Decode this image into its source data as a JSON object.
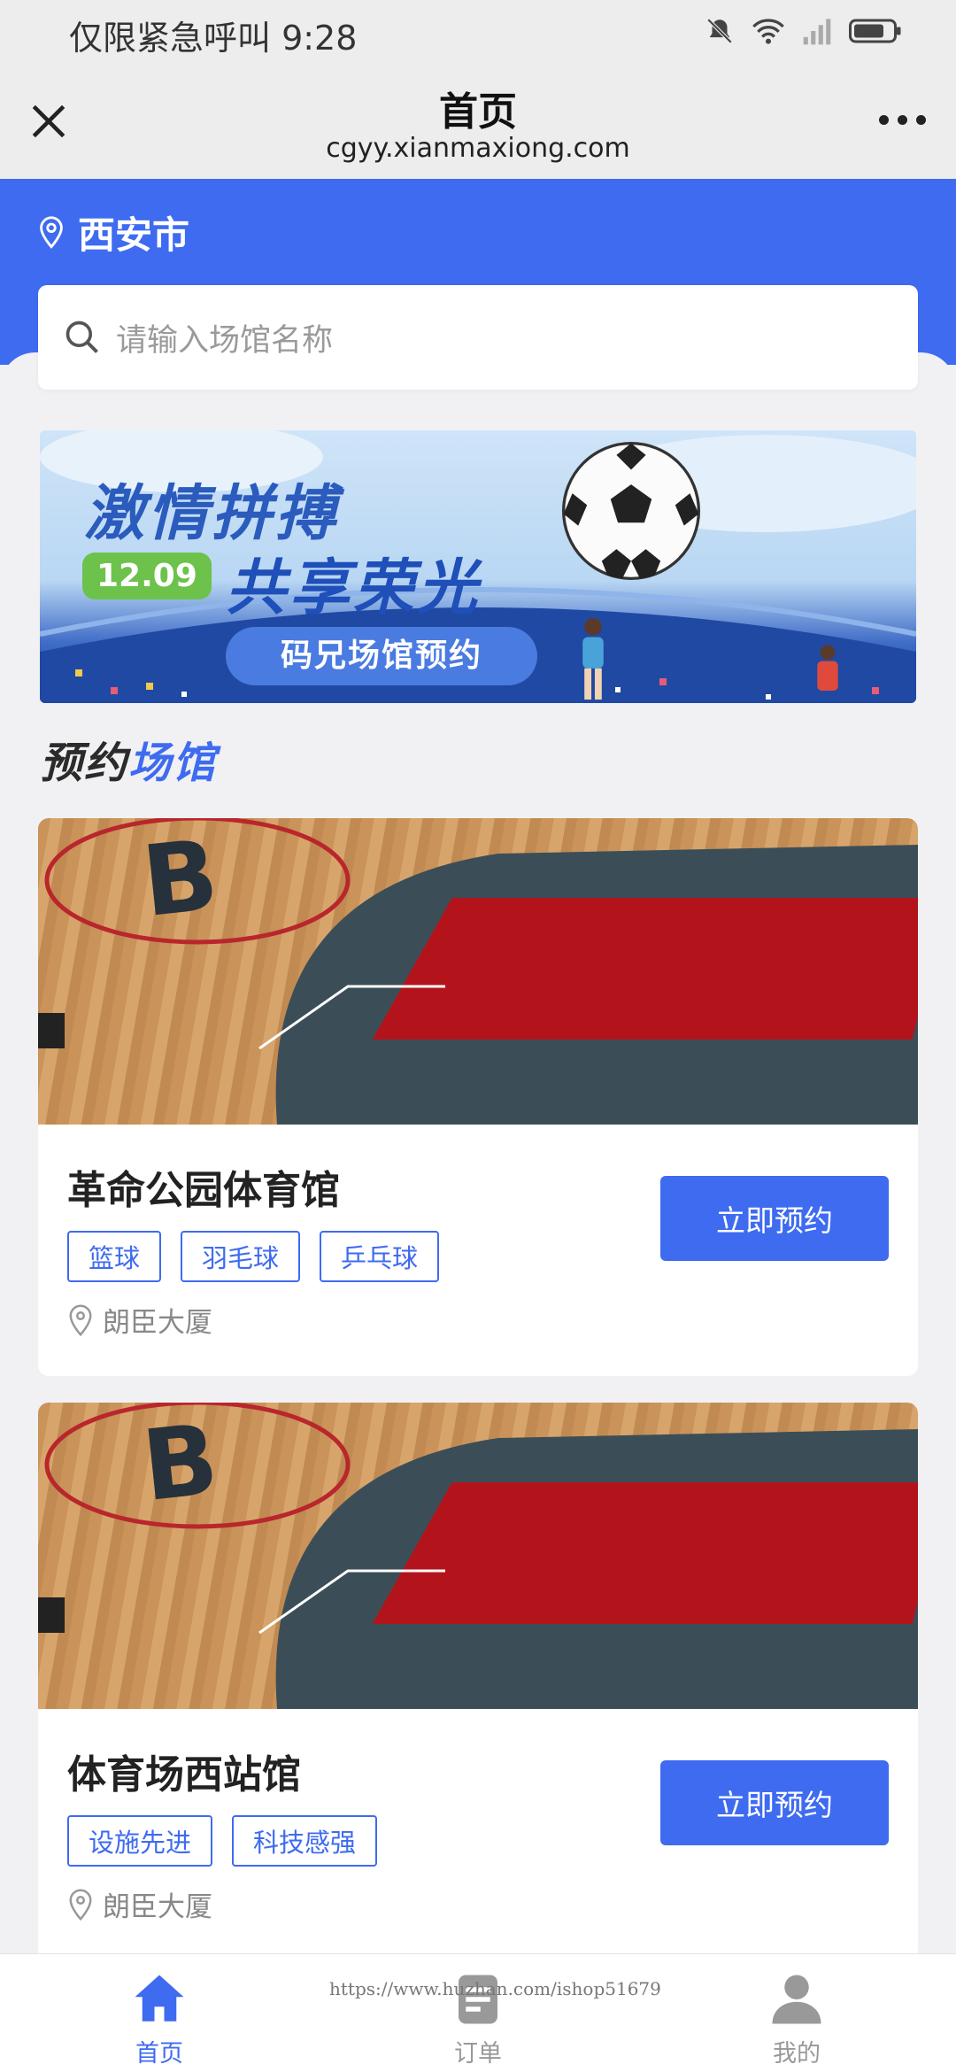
{
  "status_bar": {
    "text": "仅限紧急呼叫 9:28"
  },
  "nav": {
    "title": "首页",
    "domain": "cgyy.xianmaxiong.com"
  },
  "location": {
    "city": "西安市"
  },
  "search": {
    "placeholder": "请输入场馆名称"
  },
  "banner": {
    "line1": "激情拼搏",
    "date": "12.09",
    "line2": "共享荣光",
    "subtitle": "码兄场馆预约"
  },
  "section": {
    "title_part1": "预约",
    "title_part2": "场馆"
  },
  "venues": [
    {
      "name": "革命公园体育馆",
      "tags": [
        "篮球",
        "羽毛球",
        "乒乓球"
      ],
      "address": "朗臣大厦",
      "button": "立即预约"
    },
    {
      "name": "体育场西站馆",
      "tags": [
        "设施先进",
        "科技感强"
      ],
      "address": "朗臣大厦",
      "button": "立即预约"
    }
  ],
  "tabs": [
    {
      "label": "首页",
      "icon": "home-icon",
      "active": true
    },
    {
      "label": "订单",
      "icon": "order-icon",
      "active": false
    },
    {
      "label": "我的",
      "icon": "user-icon",
      "active": false
    }
  ],
  "watermark": "https://www.huzhan.com/ishop51679",
  "colors": {
    "primary": "#3e6bf0",
    "page_bg": "#f1f1f3",
    "tag_border": "#3e6bf0"
  }
}
